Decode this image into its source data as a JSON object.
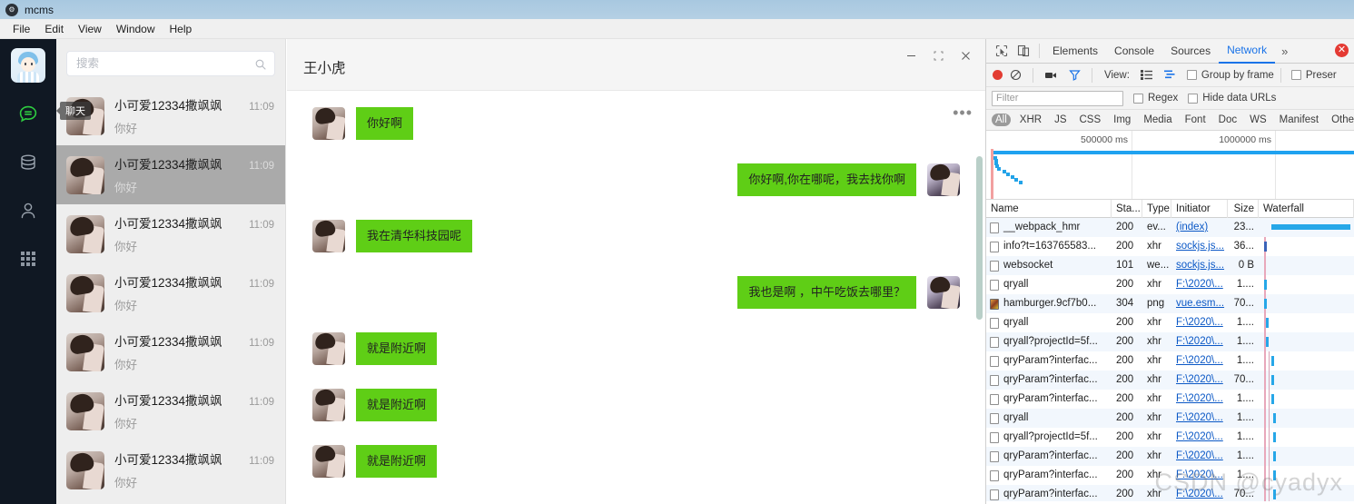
{
  "window": {
    "title": "mcms",
    "app_icon": "gear-icon",
    "menu": [
      "File",
      "Edit",
      "View",
      "Window",
      "Help"
    ]
  },
  "im": {
    "rail": {
      "avatar_name": "user-avatar",
      "items": [
        {
          "icon": "chat-bubble-icon",
          "name": "chat",
          "active": true
        },
        {
          "icon": "database-icon",
          "name": "database",
          "active": false
        },
        {
          "icon": "contact-person-icon",
          "name": "contacts",
          "active": false
        },
        {
          "icon": "apps-grid-icon",
          "name": "apps",
          "active": false
        }
      ],
      "active_color": "#2ecc40"
    },
    "search": {
      "placeholder": "搜索",
      "value": "",
      "icon": "search-icon"
    },
    "chat_list": [
      {
        "name": "小可爱12334撒飒飒",
        "time": "11:09",
        "preview": "你好",
        "selected": false,
        "tooltip": "聊天"
      },
      {
        "name": "小可爱12334撒飒飒",
        "time": "11:09",
        "preview": "你好",
        "selected": true,
        "tooltip": ""
      },
      {
        "name": "小可爱12334撒飒飒",
        "time": "11:09",
        "preview": "你好",
        "selected": false,
        "tooltip": ""
      },
      {
        "name": "小可爱12334撒飒飒",
        "time": "11:09",
        "preview": "你好",
        "selected": false,
        "tooltip": ""
      },
      {
        "name": "小可爱12334撒飒飒",
        "time": "11:09",
        "preview": "你好",
        "selected": false,
        "tooltip": ""
      },
      {
        "name": "小可爱12334撒飒飒",
        "time": "11:09",
        "preview": "你好",
        "selected": false,
        "tooltip": ""
      },
      {
        "name": "小可爱12334撒飒飒",
        "time": "11:09",
        "preview": "你好",
        "selected": false,
        "tooltip": ""
      }
    ],
    "conversation": {
      "title": "王小虎",
      "more_label": "•••",
      "window_controls": [
        {
          "name": "minimize",
          "glyph": "—"
        },
        {
          "name": "maximize",
          "glyph": "❐"
        },
        {
          "name": "close",
          "glyph": "✕"
        }
      ],
      "bubble_color": "#5fce16",
      "messages": [
        {
          "side": "in",
          "text": "你好啊"
        },
        {
          "side": "out",
          "text": "你好啊,你在哪呢，我去找你啊"
        },
        {
          "side": "in",
          "text": "我在清华科技园呢"
        },
        {
          "side": "out",
          "text": "我也是啊 ，中午吃饭去哪里？"
        },
        {
          "side": "in",
          "text": "就是附近啊"
        },
        {
          "side": "in",
          "text": "就是附近啊"
        },
        {
          "side": "in",
          "text": "就是附近啊"
        }
      ]
    }
  },
  "devtools": {
    "tabs": [
      {
        "label": "Elements",
        "active": false
      },
      {
        "label": "Console",
        "active": false
      },
      {
        "label": "Sources",
        "active": false
      },
      {
        "label": "Network",
        "active": true
      }
    ],
    "more_tabs_glyph": "»",
    "error_badge": "✕",
    "left_icons": [
      {
        "name": "inspect-element-icon"
      },
      {
        "name": "device-toolbar-icon"
      }
    ],
    "toolbar": {
      "record_label": "record-button",
      "clear_label": "clear-button",
      "capture_screenshots_label": "camera-icon",
      "filter_toggle_label": "filter-funnel-icon",
      "view_label": "View:",
      "view_icons": [
        "list-view-icon",
        "waterfall-view-icon"
      ],
      "group_by_frame": "Group by frame",
      "preserve_log": "Preser"
    },
    "filterbar": {
      "filter_placeholder": "Filter",
      "filter_value": "",
      "regex_label": "Regex",
      "hide_data_urls_label": "Hide data URLs"
    },
    "type_filters": [
      {
        "label": "All",
        "on": true
      },
      {
        "label": "XHR",
        "on": false
      },
      {
        "label": "JS",
        "on": false
      },
      {
        "label": "CSS",
        "on": false
      },
      {
        "label": "Img",
        "on": false
      },
      {
        "label": "Media",
        "on": false
      },
      {
        "label": "Font",
        "on": false
      },
      {
        "label": "Doc",
        "on": false
      },
      {
        "label": "WS",
        "on": false
      },
      {
        "label": "Manifest",
        "on": false
      },
      {
        "label": "Other",
        "on": false
      }
    ],
    "overview": {
      "ticks": [
        "500000 ms",
        "1000000 ms"
      ]
    },
    "columns": [
      "Name",
      "Sta...",
      "Type",
      "Initiator",
      "Size",
      "Waterfall"
    ],
    "requests": [
      {
        "name": "__webpack_hmr",
        "status": "200",
        "type": "ev...",
        "initiator": "(index)",
        "size": "23...",
        "icon": "doc",
        "bar": "full"
      },
      {
        "name": "info?t=163765583...",
        "status": "200",
        "type": "xhr",
        "initiator": "sockjs.js...",
        "size": "36...",
        "icon": "doc",
        "bar": "dark"
      },
      {
        "name": "websocket",
        "status": "101",
        "type": "we...",
        "initiator": "sockjs.js...",
        "size": "0 B",
        "icon": "doc",
        "bar": "none"
      },
      {
        "name": "qryall",
        "status": "200",
        "type": "xhr",
        "initiator": "F:\\2020\\...",
        "size": "1....",
        "icon": "doc",
        "bar": "tick"
      },
      {
        "name": "hamburger.9cf7b0...",
        "status": "304",
        "type": "png",
        "initiator": "vue.esm...",
        "size": "70...",
        "icon": "img",
        "bar": "tick"
      },
      {
        "name": "qryall",
        "status": "200",
        "type": "xhr",
        "initiator": "F:\\2020\\...",
        "size": "1....",
        "icon": "doc",
        "bar": "tick"
      },
      {
        "name": "qryall?projectId=5f...",
        "status": "200",
        "type": "xhr",
        "initiator": "F:\\2020\\...",
        "size": "1....",
        "icon": "doc",
        "bar": "tick"
      },
      {
        "name": "qryParam?interfac...",
        "status": "200",
        "type": "xhr",
        "initiator": "F:\\2020\\...",
        "size": "1....",
        "icon": "doc",
        "bar": "tick"
      },
      {
        "name": "qryParam?interfac...",
        "status": "200",
        "type": "xhr",
        "initiator": "F:\\2020\\...",
        "size": "70...",
        "icon": "doc",
        "bar": "tick"
      },
      {
        "name": "qryParam?interfac...",
        "status": "200",
        "type": "xhr",
        "initiator": "F:\\2020\\...",
        "size": "1....",
        "icon": "doc",
        "bar": "tick"
      },
      {
        "name": "qryall",
        "status": "200",
        "type": "xhr",
        "initiator": "F:\\2020\\...",
        "size": "1....",
        "icon": "doc",
        "bar": "tick"
      },
      {
        "name": "qryall?projectId=5f...",
        "status": "200",
        "type": "xhr",
        "initiator": "F:\\2020\\...",
        "size": "1....",
        "icon": "doc",
        "bar": "tick"
      },
      {
        "name": "qryParam?interfac...",
        "status": "200",
        "type": "xhr",
        "initiator": "F:\\2020\\...",
        "size": "1....",
        "icon": "doc",
        "bar": "tick"
      },
      {
        "name": "qryParam?interfac...",
        "status": "200",
        "type": "xhr",
        "initiator": "F:\\2020\\...",
        "size": "1....",
        "icon": "doc",
        "bar": "tick"
      },
      {
        "name": "qryParam?interfac...",
        "status": "200",
        "type": "xhr",
        "initiator": "F:\\2020\\...",
        "size": "70...",
        "icon": "doc",
        "bar": "tick"
      }
    ]
  },
  "watermark": "CSDN @cyadyx"
}
